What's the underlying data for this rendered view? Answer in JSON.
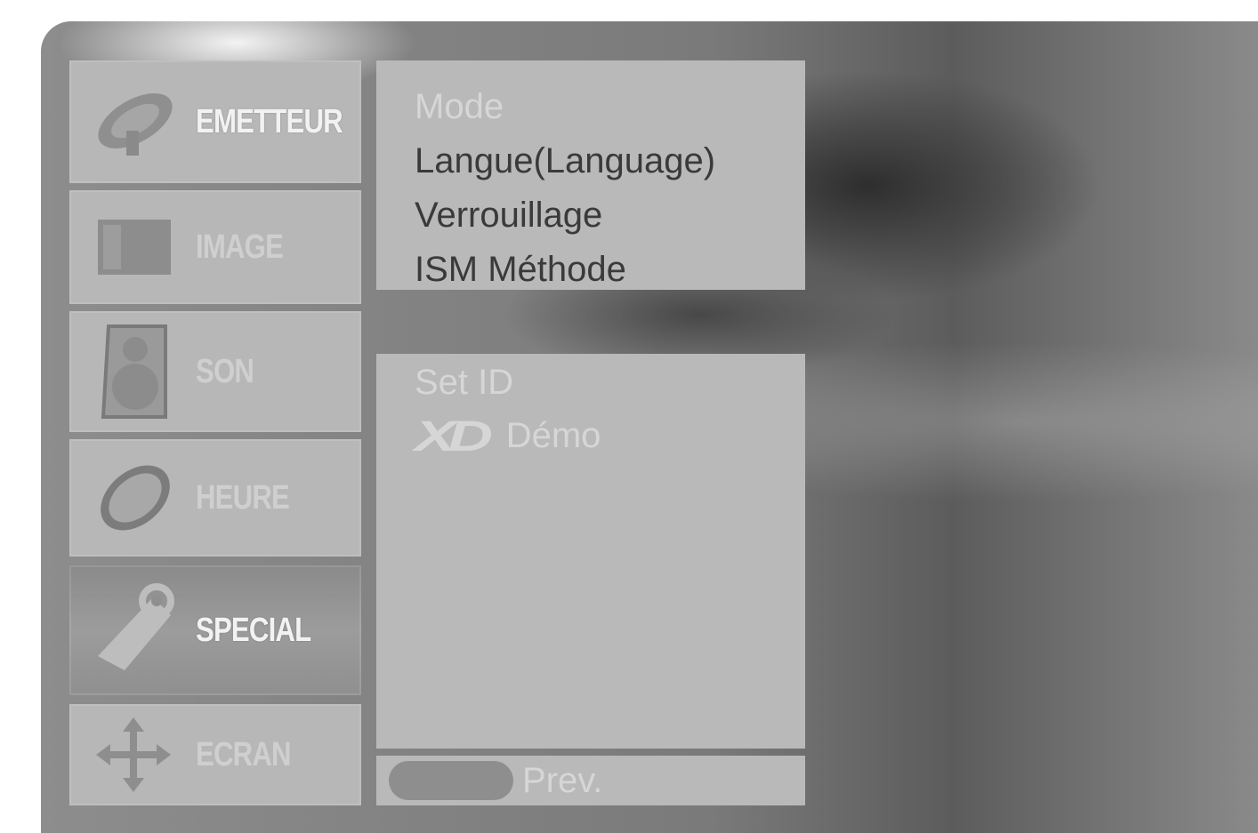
{
  "sidebar": {
    "items": [
      {
        "label": "EMETTEUR",
        "icon": "satellite-dish-icon",
        "active": false
      },
      {
        "label": "IMAGE",
        "icon": "picture-icon",
        "active": false
      },
      {
        "label": "SON",
        "icon": "speaker-icon",
        "active": false
      },
      {
        "label": "HEURE",
        "icon": "clock-icon",
        "active": false
      },
      {
        "label": "SPECIAL",
        "icon": "key-tag-icon",
        "active": true
      },
      {
        "label": "ECRAN",
        "icon": "move-arrows-icon",
        "active": false
      }
    ]
  },
  "submenu_top": {
    "items": [
      {
        "label": "Mode",
        "state": "disabled"
      },
      {
        "label": "Langue(Language)",
        "state": "enabled"
      },
      {
        "label": "Verrouillage",
        "state": "enabled"
      },
      {
        "label": "ISM Méthode",
        "state": "enabled"
      }
    ]
  },
  "submenu_bottom": {
    "set_id_label": "Set ID",
    "xd_logo": "XD",
    "demo_label": "Démo"
  },
  "footer": {
    "prev_label": "Prev."
  },
  "colors": {
    "panel": "#b9b9b9",
    "text_enabled": "#3a3a3a",
    "text_disabled": "#d6d6d6",
    "active_item": "#8f8f8f"
  }
}
